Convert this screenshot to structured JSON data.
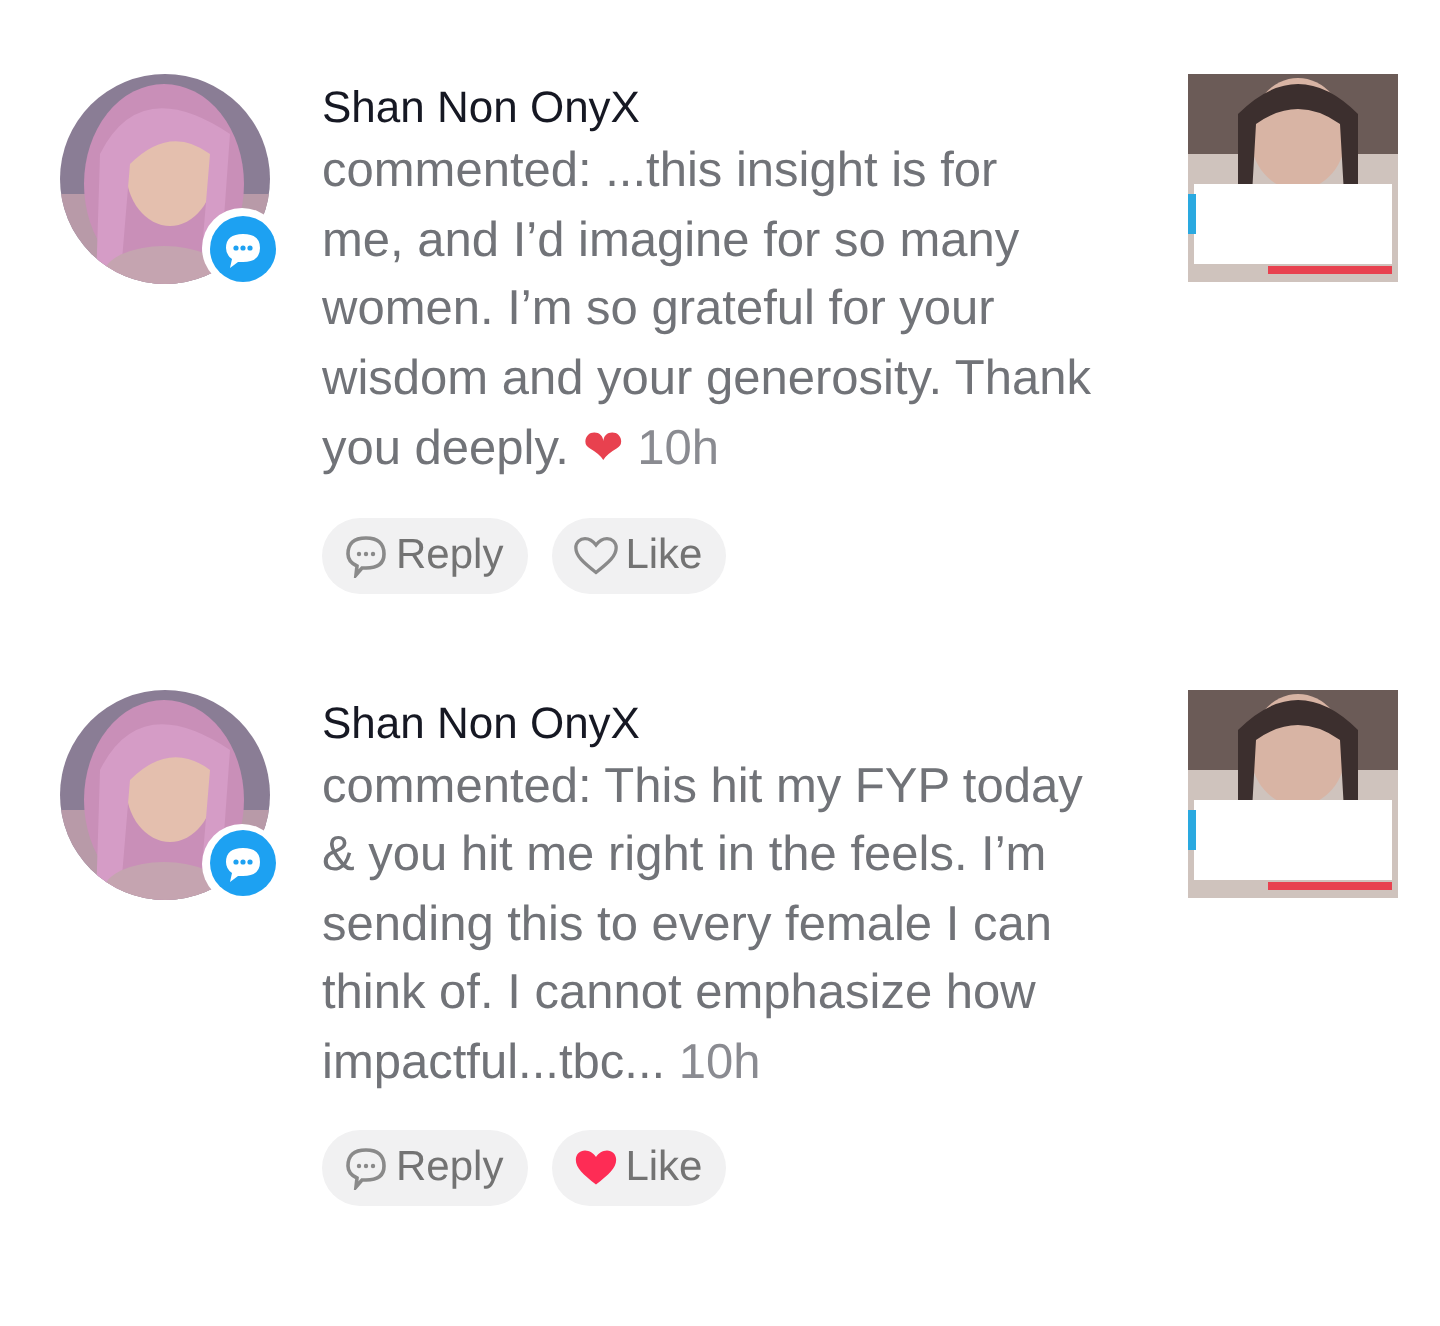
{
  "comments": [
    {
      "author": "Shan Non OnyX",
      "text": "commented: ...this insight is for me, and I’d imagine for so many women. I’m so grateful for your wisdom and your generosity. Thank you deeply.",
      "emoji": "❤",
      "time": "10h",
      "reply_label": "Reply",
      "like_label": "Like",
      "liked": false
    },
    {
      "author": "Shan Non OnyX",
      "text": "commented: This hit my FYP today & you hit me right in the feels. I’m sending this to every female I can think of. I cannot emphasize how impactful...tbc...",
      "time": "10h",
      "reply_label": "Reply",
      "like_label": "Like",
      "liked": true
    }
  ]
}
